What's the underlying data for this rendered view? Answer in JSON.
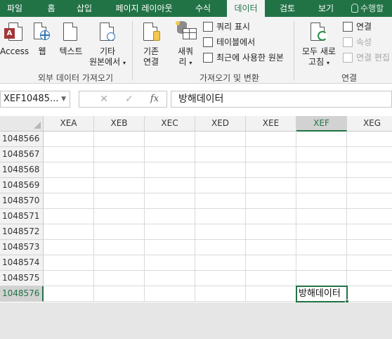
{
  "tabs": [
    {
      "label": "파일",
      "active": false
    },
    {
      "label": "홈",
      "active": false
    },
    {
      "label": "삽입",
      "active": false
    },
    {
      "label": "페이지 레이아웃",
      "active": false
    },
    {
      "label": "수식",
      "active": false
    },
    {
      "label": "데이터",
      "active": true
    },
    {
      "label": "검토",
      "active": false
    },
    {
      "label": "보기",
      "active": false
    }
  ],
  "tell_me": "수행할",
  "ribbon": {
    "groups": {
      "external": {
        "label": "외부 데이터 가져오기",
        "access": "Access",
        "web": "웹",
        "text": "텍스트",
        "other_line1": "기타",
        "other_line2": "원본에서"
      },
      "getTransform": {
        "label": "가져오기 및 변환",
        "existing_line1": "기존",
        "existing_line2": "연결",
        "newquery_line1": "새쿼",
        "newquery_line2": "리",
        "show_queries": "쿼리 표시",
        "from_table": "테이블에서",
        "recent_sources": "최근에 사용한 원본"
      },
      "connections": {
        "label": "연결",
        "refresh_line1": "모두 새로",
        "refresh_line2": "고침",
        "connections": "연결",
        "properties": "속성",
        "edit_links": "연결 편집"
      }
    }
  },
  "formula_bar": {
    "name_box": "XEF10485...",
    "cancel": "✕",
    "enter": "✓",
    "fx": "fx",
    "value": "방해데이터"
  },
  "grid": {
    "columns": [
      "XEA",
      "XEB",
      "XEC",
      "XED",
      "XEE",
      "XEF",
      "XEG"
    ],
    "selected_column": "XEF",
    "rows": [
      "1048566",
      "1048567",
      "1048568",
      "1048569",
      "1048570",
      "1048571",
      "1048572",
      "1048573",
      "1048574",
      "1048575",
      "1048576"
    ],
    "selected_row": "1048576",
    "active_cell_value": "방해데이터"
  },
  "colors": {
    "accent": "#217346"
  }
}
